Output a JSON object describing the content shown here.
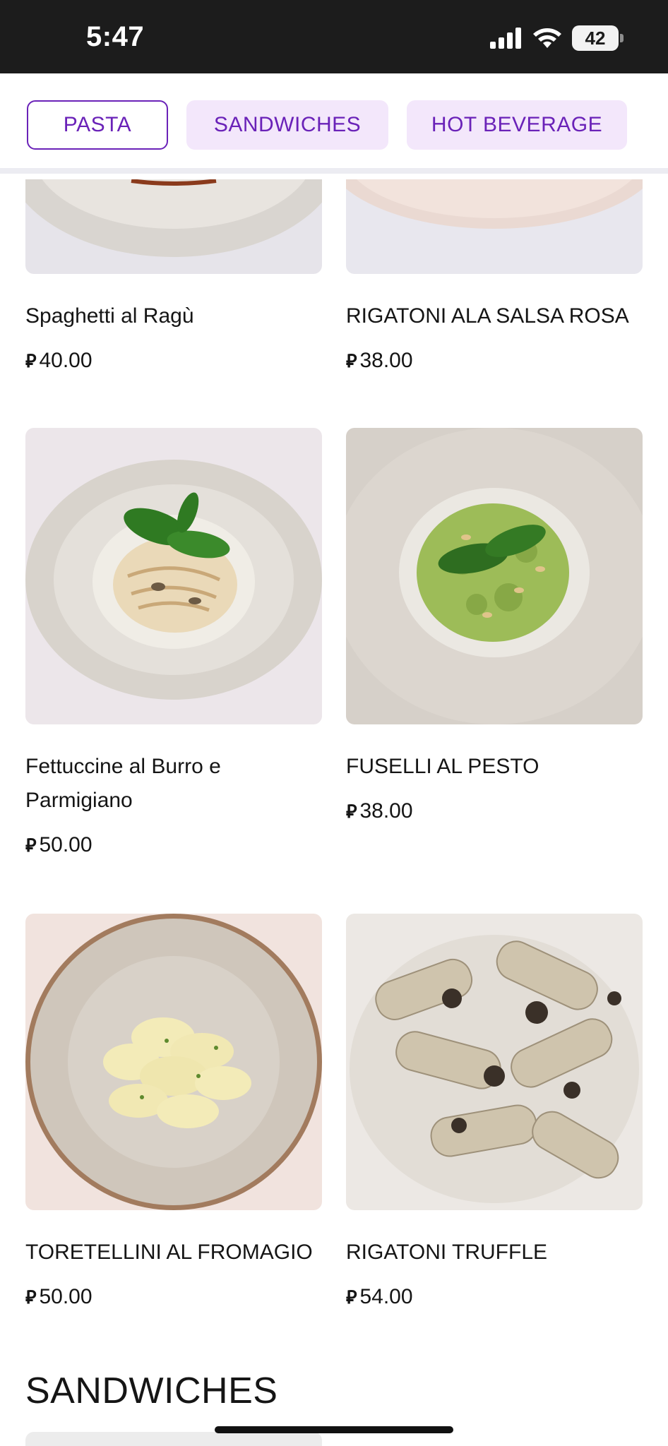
{
  "status": {
    "time": "5:47",
    "battery": "42"
  },
  "tabs": [
    {
      "label": "PASTA"
    },
    {
      "label": "SANDWICHES"
    },
    {
      "label": "HOT BEVERAGE"
    }
  ],
  "items": [
    {
      "name": "Spaghetti al Ragù",
      "price": "40.00"
    },
    {
      "name": "RIGATONI ALA SALSA ROSA",
      "price": "38.00"
    },
    {
      "name": "Fettuccine al Burro e Parmigiano",
      "price": "50.00"
    },
    {
      "name": "FUSELLI AL PESTO",
      "price": "38.00"
    },
    {
      "name": "TORETELLINI AL FROMAGIO",
      "price": "50.00"
    },
    {
      "name": "RIGATONI TRUFFLE",
      "price": "54.00"
    }
  ],
  "currency_symbol": "⃁",
  "next_section": {
    "title": "SANDWICHES"
  },
  "colors": {
    "accent": "#6a22b8",
    "tab_bg": "#f3e7fb"
  }
}
